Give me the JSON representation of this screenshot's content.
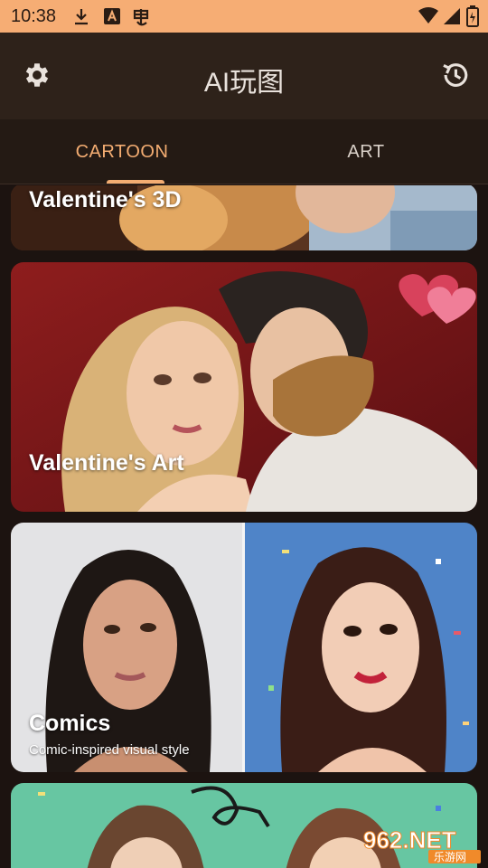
{
  "status_bar": {
    "time": "10:38",
    "icons_left": [
      "download-icon",
      "font-a-icon",
      "bug-icon"
    ],
    "icons_right": [
      "wifi-icon",
      "cellular-signal-icon",
      "battery-icon"
    ]
  },
  "app_bar": {
    "title": "AI玩图",
    "left_icon": "settings-gear-icon",
    "right_icon": "history-icon"
  },
  "tabs": [
    {
      "label": "CARTOON",
      "active": true
    },
    {
      "label": "ART",
      "active": false
    }
  ],
  "cards": [
    {
      "title": "Valentine's 3D",
      "subtitle": ""
    },
    {
      "title": "Valentine's Art",
      "subtitle": ""
    },
    {
      "title": "Comics",
      "subtitle": "Comic-inspired visual style"
    },
    {
      "title": "",
      "subtitle": ""
    }
  ],
  "watermark": {
    "brand": "962.NET",
    "caption": "乐游网"
  },
  "colors": {
    "status_bar": "#f6ad74",
    "app_bar": "#2e221a",
    "tab_bar": "#241a14",
    "accent": "#f4ad72",
    "background": "#1c1310"
  }
}
